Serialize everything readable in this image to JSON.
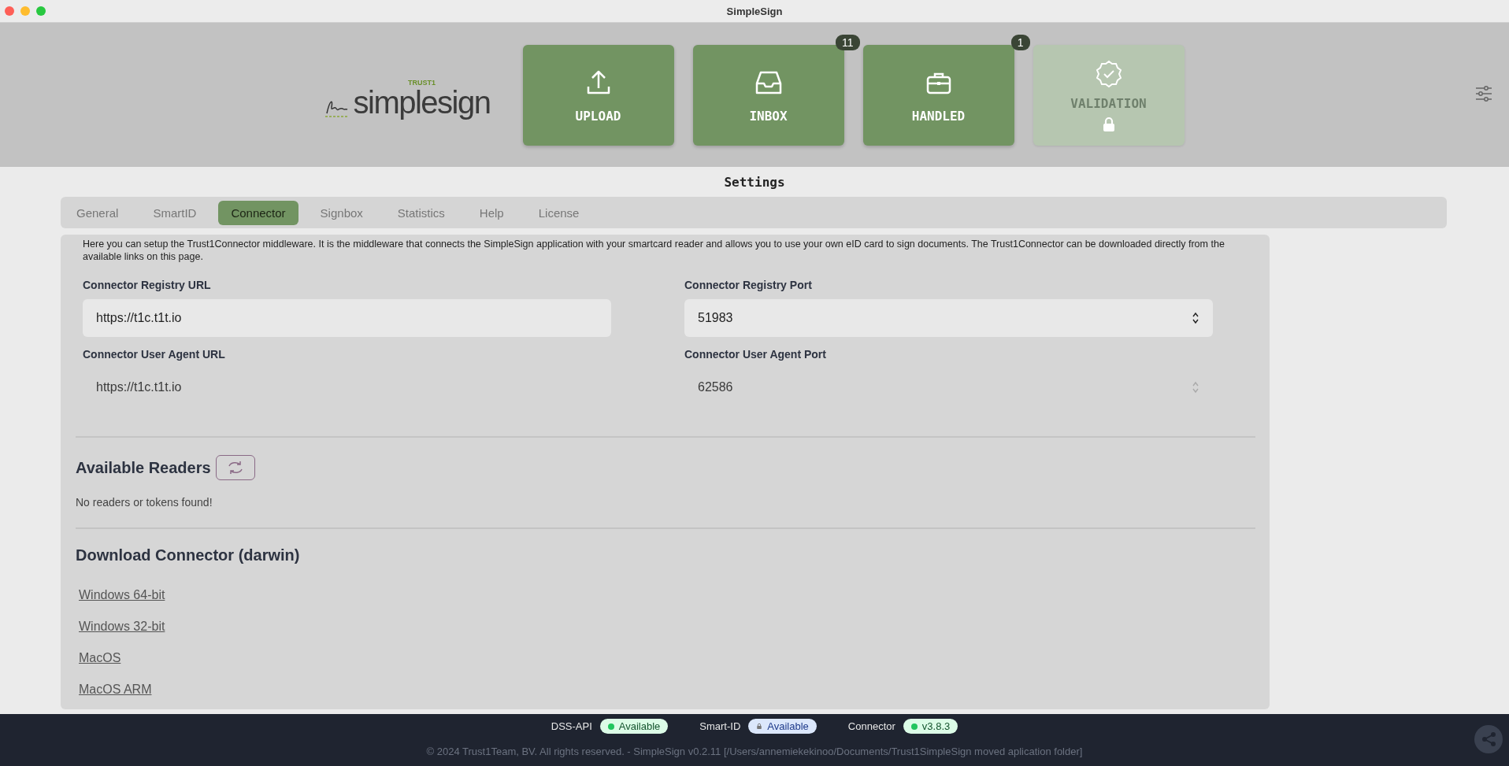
{
  "window": {
    "title": "SimpleSign"
  },
  "header": {
    "logo": {
      "tagline": "TRUST1",
      "brand_first": "simple",
      "brand_second": "sign"
    },
    "nav": [
      {
        "label": "UPLOAD",
        "kind": "upload",
        "disabled": false
      },
      {
        "label": "INBOX",
        "kind": "inbox",
        "badge": "11",
        "disabled": false
      },
      {
        "label": "HANDLED",
        "kind": "handled",
        "badge": "1",
        "disabled": false
      },
      {
        "label": "VALIDATION",
        "kind": "validation",
        "disabled": true
      }
    ]
  },
  "settings": {
    "title": "Settings",
    "tabs": [
      {
        "label": "General",
        "selected": false
      },
      {
        "label": "SmartID",
        "selected": false
      },
      {
        "label": "Connector",
        "selected": true
      },
      {
        "label": "Signbox",
        "selected": false
      },
      {
        "label": "Statistics",
        "selected": false
      },
      {
        "label": "Help",
        "selected": false
      },
      {
        "label": "License",
        "selected": false
      }
    ],
    "description": "Here you can setup the Trust1Connector middleware. It is the middleware that connects the SimpleSign application with your smartcard reader and allows you to use your own eID card to sign documents. The Trust1Connector can be downloaded directly from the available links on this page.",
    "fields": [
      {
        "label": "Connector Registry URL",
        "value": "https://t1c.t1t.io",
        "kind": "text",
        "disabled": false
      },
      {
        "label": "Connector Registry Port",
        "value": "51983",
        "kind": "number",
        "disabled": false
      },
      {
        "label": "Connector User Agent URL",
        "value": "https://t1c.t1t.io",
        "kind": "text",
        "disabled": true
      },
      {
        "label": "Connector User Agent Port",
        "value": "62586",
        "kind": "number",
        "disabled": true
      }
    ],
    "readers": {
      "heading": "Available Readers",
      "message": "No readers or tokens found!"
    },
    "download": {
      "heading": "Download Connector (darwin)",
      "links": [
        "Windows 64-bit",
        "Windows 32-bit",
        "MacOS",
        "MacOS ARM"
      ]
    }
  },
  "status_bar": {
    "items": [
      {
        "label": "DSS-API",
        "value": "Available",
        "kind": "dot",
        "color": "#22c55e"
      },
      {
        "label": "Smart-ID",
        "value": "Available",
        "kind": "lock",
        "color": "#dbe7fb"
      },
      {
        "label": "Connector",
        "value": "v3.8.3",
        "kind": "dot",
        "color": "#22c55e"
      }
    ],
    "copyright": "© 2024 Trust1Team, BV. All rights reserved. - SimpleSign v0.2.11 [/Users/annemiekekinoo/Documents/Trust1SimpleSign moved aplication folder]"
  }
}
